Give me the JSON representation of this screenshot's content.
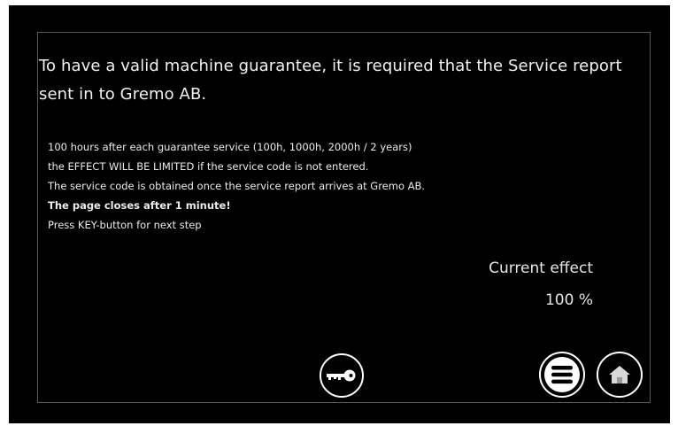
{
  "notice": {
    "headline": "To have a valid machine guarantee, it is required that the Service report sent in to Gremo AB.",
    "lines": [
      "100 hours after each guarantee service (100h, 1000h, 2000h / 2 years)",
      "the EFFECT WILL BE LIMITED if the service code is not entered.",
      "The service code is obtained once the service report arrives at Gremo AB.",
      "The page closes after 1 minute!",
      "Press KEY-button for next step"
    ]
  },
  "effect": {
    "label": "Current effect",
    "value": "100 %"
  },
  "buttons": {
    "key_icon": "key-icon",
    "menu_icon": "menu-icon",
    "home_icon": "home-icon"
  }
}
